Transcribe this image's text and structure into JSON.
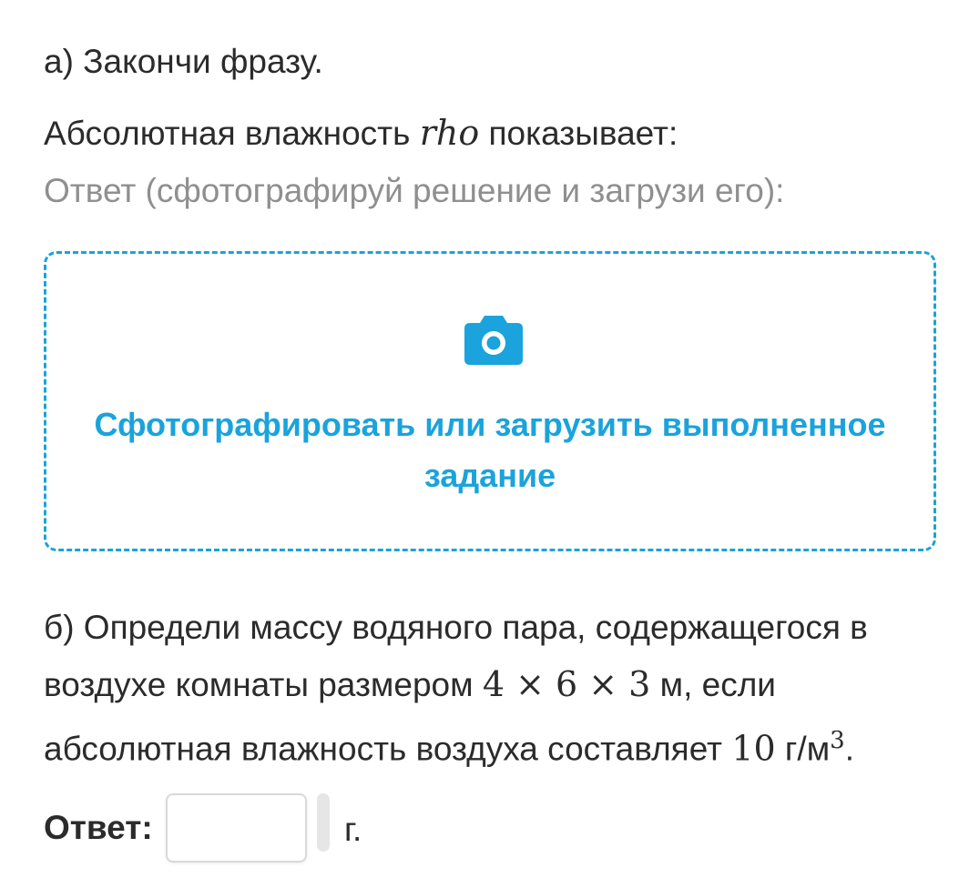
{
  "part_a": {
    "title": "а) Закончи фразу.",
    "sentence_prefix": "Абсолютная влажность ",
    "sentence_symbol": "rho",
    "sentence_suffix": " показывает:",
    "answer_hint": "Ответ (сфотографируй решение и загрузи его):"
  },
  "upload": {
    "icon": "camera-icon",
    "label_line1": "Сфотографировать или загрузить выполненное",
    "label_line2": "задание",
    "accent_color": "#1aa3dc"
  },
  "part_b": {
    "line1": "б) Определи массу водяного пара, содержащегося в",
    "line2_prefix": "воздухе комнаты размером ",
    "line2_dims": "4 × 6 × 3",
    "line2_suffix": " м, если",
    "line3_prefix": "абсолютная влажность воздуха составляет ",
    "line3_value": "10",
    "line3_unit": " г/м",
    "line3_exp": "3",
    "line3_end": "."
  },
  "answer": {
    "label": "Ответ:",
    "value": "",
    "unit": "г."
  }
}
